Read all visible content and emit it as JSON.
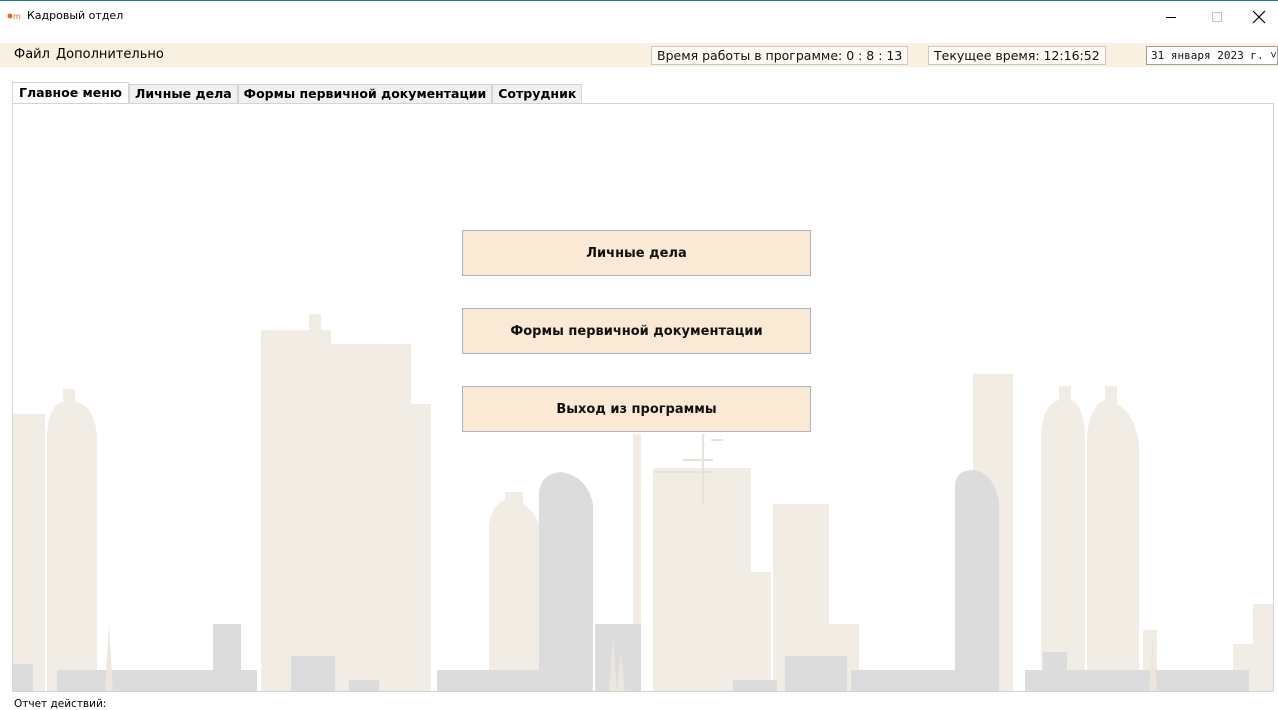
{
  "window": {
    "title": "Кадровый отдел",
    "minimize_glyph": "—",
    "maximize_glyph": "☐",
    "close_glyph": "✕"
  },
  "menu": {
    "file": "Файл",
    "extra": "Дополнительно"
  },
  "status": {
    "work_time": "Время работы в программе: 0 : 8 : 13",
    "current_time": "Текущее время: 12:16:52",
    "date": "31 января 2023 г. ˅"
  },
  "tabs": [
    {
      "label": "Главное меню",
      "active": true
    },
    {
      "label": "Личные дела",
      "active": false
    },
    {
      "label": "Формы первичной документации",
      "active": false
    },
    {
      "label": "Сотрудник",
      "active": false
    }
  ],
  "main": {
    "personal_files_button": "Личные дела",
    "primary_docs_button": "Формы первичной документации",
    "exit_button": "Выход из программы"
  },
  "footer": {
    "log_label": "Отчет действий:"
  },
  "colors": {
    "menubar_bg": "#faf0e2",
    "button_bg": "#fae9d4",
    "skyline_beige": "#f2ede4",
    "skyline_gray": "#dcdcdc",
    "accent_icon": "#e86a2a"
  },
  "icons": {
    "app": "app-logo-icon"
  }
}
